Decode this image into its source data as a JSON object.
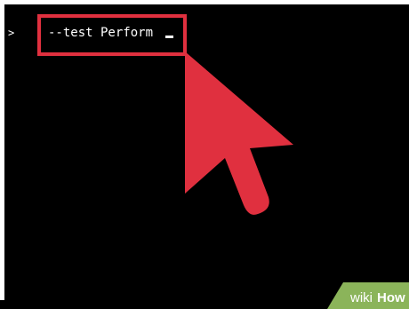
{
  "terminal": {
    "prompt_symbol": ">",
    "command_text": "--test Perform"
  },
  "icons": {
    "pointer": "cursor-arrow-icon",
    "watermark": "wikihow-logo"
  },
  "colors": {
    "background": "#000000",
    "text": "#ffffff",
    "highlight": "#e0303f",
    "watermark_green": "#8bb45a"
  },
  "watermark": {
    "prefix": "wiki",
    "suffix": "How"
  }
}
